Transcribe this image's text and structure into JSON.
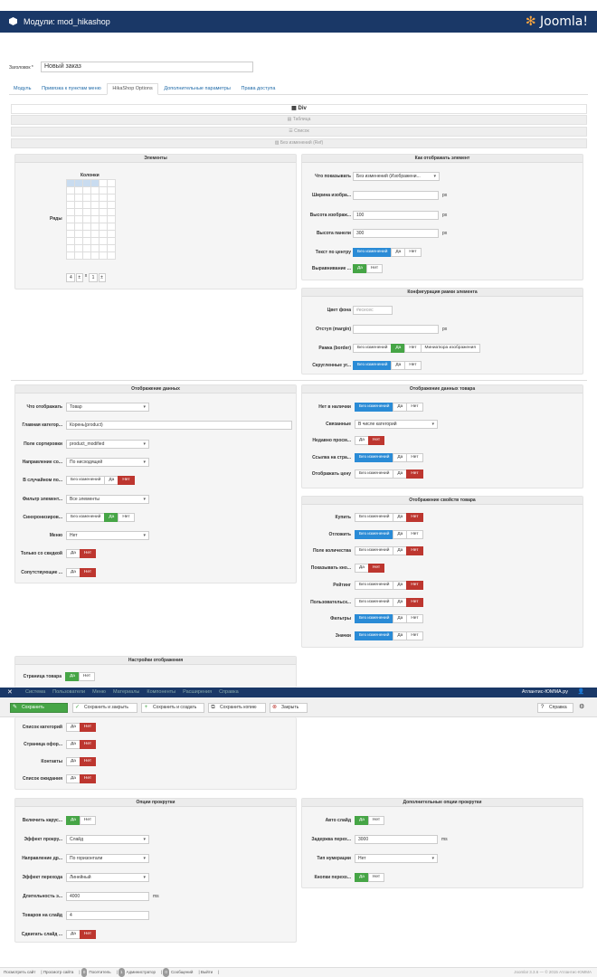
{
  "header": {
    "title": "Модули: mod_hikashop",
    "brand": "Joomla!"
  },
  "title_field": {
    "label": "Заголовок *",
    "value": "Новый заказ"
  },
  "tabs": [
    "Модуль",
    "Привязка к пунктам меню",
    "HikaShop Options",
    "Дополнительные параметры",
    "Права доступа"
  ],
  "layouts": [
    "Div",
    "Таблица",
    "Список",
    "Без изменений (Ref)"
  ],
  "elements": {
    "title": "Элементы",
    "columns_label": "Колонки",
    "rows_label": "Ряды",
    "rows_val": "4",
    "x": "x",
    "cols_val": "1"
  },
  "display_elems": {
    "title": "Как отображать элемент",
    "what_label": "Что показывать",
    "what_val": "Без изменений (Изображени...",
    "wimg_label": "Ширина изобра...",
    "himg_label": "Высота изображ...",
    "himg_val": "100",
    "hpanel_label": "Высота панели",
    "hpanel_val": "300",
    "center_label": "Текст по центру",
    "align_label": "Выравнивание ...",
    "px": "px"
  },
  "frame": {
    "title": "Конфигурация рамки элемента",
    "bg_label": "Цвет фона",
    "bg_val": "#ececec",
    "margin_label": "Отступ (margin)",
    "border_label": "Рамка (border)",
    "thumb": "Миниатюра изображения",
    "round_label": "Скругленные уг..."
  },
  "data_disp": {
    "title": "Отображение данных",
    "rows": [
      {
        "label": "Что отображать",
        "val": "Товар",
        "kind": "sel"
      },
      {
        "label": "Главная категор...",
        "val": "Корень(product)",
        "kind": "inp"
      },
      {
        "label": "Поле сортировки",
        "val": "product_modified",
        "kind": "sel"
      },
      {
        "label": "Направление со...",
        "val": "По нисходящей",
        "kind": "sel"
      },
      {
        "label": "В случайном по...",
        "kind": "tg3r"
      },
      {
        "label": "Фильтр элемент...",
        "val": "Все элементы",
        "kind": "sel"
      },
      {
        "label": "Синхронизиров...",
        "kind": "tg3g"
      },
      {
        "label": "Меню",
        "val": "Нет",
        "kind": "sel"
      },
      {
        "label": "Только со скидкой",
        "kind": "tg2r"
      },
      {
        "label": "Сопутствующие ...",
        "kind": "tg2r"
      }
    ]
  },
  "prod_data": {
    "title": "Отображение данных товара",
    "rows": [
      {
        "label": "Нет в наличии",
        "kind": "tg3b"
      },
      {
        "label": "Связанные",
        "val": "В числе категорий",
        "kind": "sel"
      },
      {
        "label": "Недавно просм...",
        "kind": "tg2r"
      },
      {
        "label": "Ссылка на стра...",
        "kind": "tg3b"
      },
      {
        "label": "Отображать цену",
        "kind": "tg3r"
      }
    ]
  },
  "prod_props": {
    "title": "Отображение свойств товара",
    "rows": [
      {
        "label": "Купить",
        "kind": "tg3r"
      },
      {
        "label": "Отложить",
        "kind": "tg3b"
      },
      {
        "label": "Поле количества",
        "kind": "tg3r"
      },
      {
        "label": "Показывать кно...",
        "kind": "tg2r"
      },
      {
        "label": "Рейтинг",
        "kind": "tg3r"
      },
      {
        "label": "Пользовательск...",
        "kind": "tg3r"
      },
      {
        "label": "Фильтры",
        "kind": "tg3b"
      },
      {
        "label": "Значки",
        "kind": "tg3b"
      }
    ]
  },
  "view_settings": {
    "title": "Настройки отображения",
    "rows": [
      {
        "label": "Страница товара",
        "kind": "tg2g"
      },
      {
        "label": "Список категорий",
        "kind": "tg2r"
      },
      {
        "label": "Страница офор...",
        "kind": "tg2r"
      },
      {
        "label": "Контакты",
        "kind": "tg2r"
      },
      {
        "label": "Список ожидания",
        "kind": "tg2r"
      }
    ]
  },
  "toggles": {
    "none": "Без изменений",
    "yes": "Да",
    "no": "Нет"
  },
  "adminbar": {
    "items": [
      "Система",
      "Пользователи",
      "Меню",
      "Материалы",
      "Компоненты",
      "Расширения",
      "Справка"
    ],
    "site": "Атлантис-ЮММА.ру"
  },
  "toolbar": {
    "save": "Сохранить",
    "save_close": "Сохранить и закрыть",
    "save_new": "Сохранить и создать",
    "save_copy": "Сохранить копию",
    "close": "Закрыть",
    "help": "Справка"
  },
  "carousel": {
    "title": "Опции прокрутки",
    "rows": [
      {
        "label": "Включить карус...",
        "kind": "tg2g"
      },
      {
        "label": "Эффект прокру...",
        "val": "Слайд",
        "kind": "sel"
      },
      {
        "label": "Направление др...",
        "val": "По горизонтали",
        "kind": "sel"
      },
      {
        "label": "Эффект перехода",
        "val": "Линейный",
        "kind": "sel"
      },
      {
        "label": "Длительность э...",
        "val": "4000",
        "kind": "inp",
        "unit": "ms"
      },
      {
        "label": "Товаров на слайд",
        "val": "4",
        "kind": "inp"
      },
      {
        "label": "Сдвигать слайд ...",
        "kind": "tg2r"
      }
    ]
  },
  "carousel_extra": {
    "title": "Дополнительные опции прокрутки",
    "rows": [
      {
        "label": "Авто слайд",
        "kind": "tg2g"
      },
      {
        "label": "Задержка перех...",
        "val": "3000",
        "kind": "inp",
        "unit": "ms"
      },
      {
        "label": "Тип нумерации",
        "val": "Нет",
        "kind": "sel"
      },
      {
        "label": "Кнопки перехо...",
        "kind": "tg2g"
      }
    ]
  },
  "statusbar": {
    "items": [
      "Посмотреть сайт",
      "Просмотр сайта",
      "Посетитель",
      "Администратор",
      "Сообщений",
      "Выйти"
    ],
    "counts": [
      "0",
      "1",
      "0"
    ],
    "version": "Joomla! 3.3.6 — © 2015 Атлантис-ЮММА"
  }
}
